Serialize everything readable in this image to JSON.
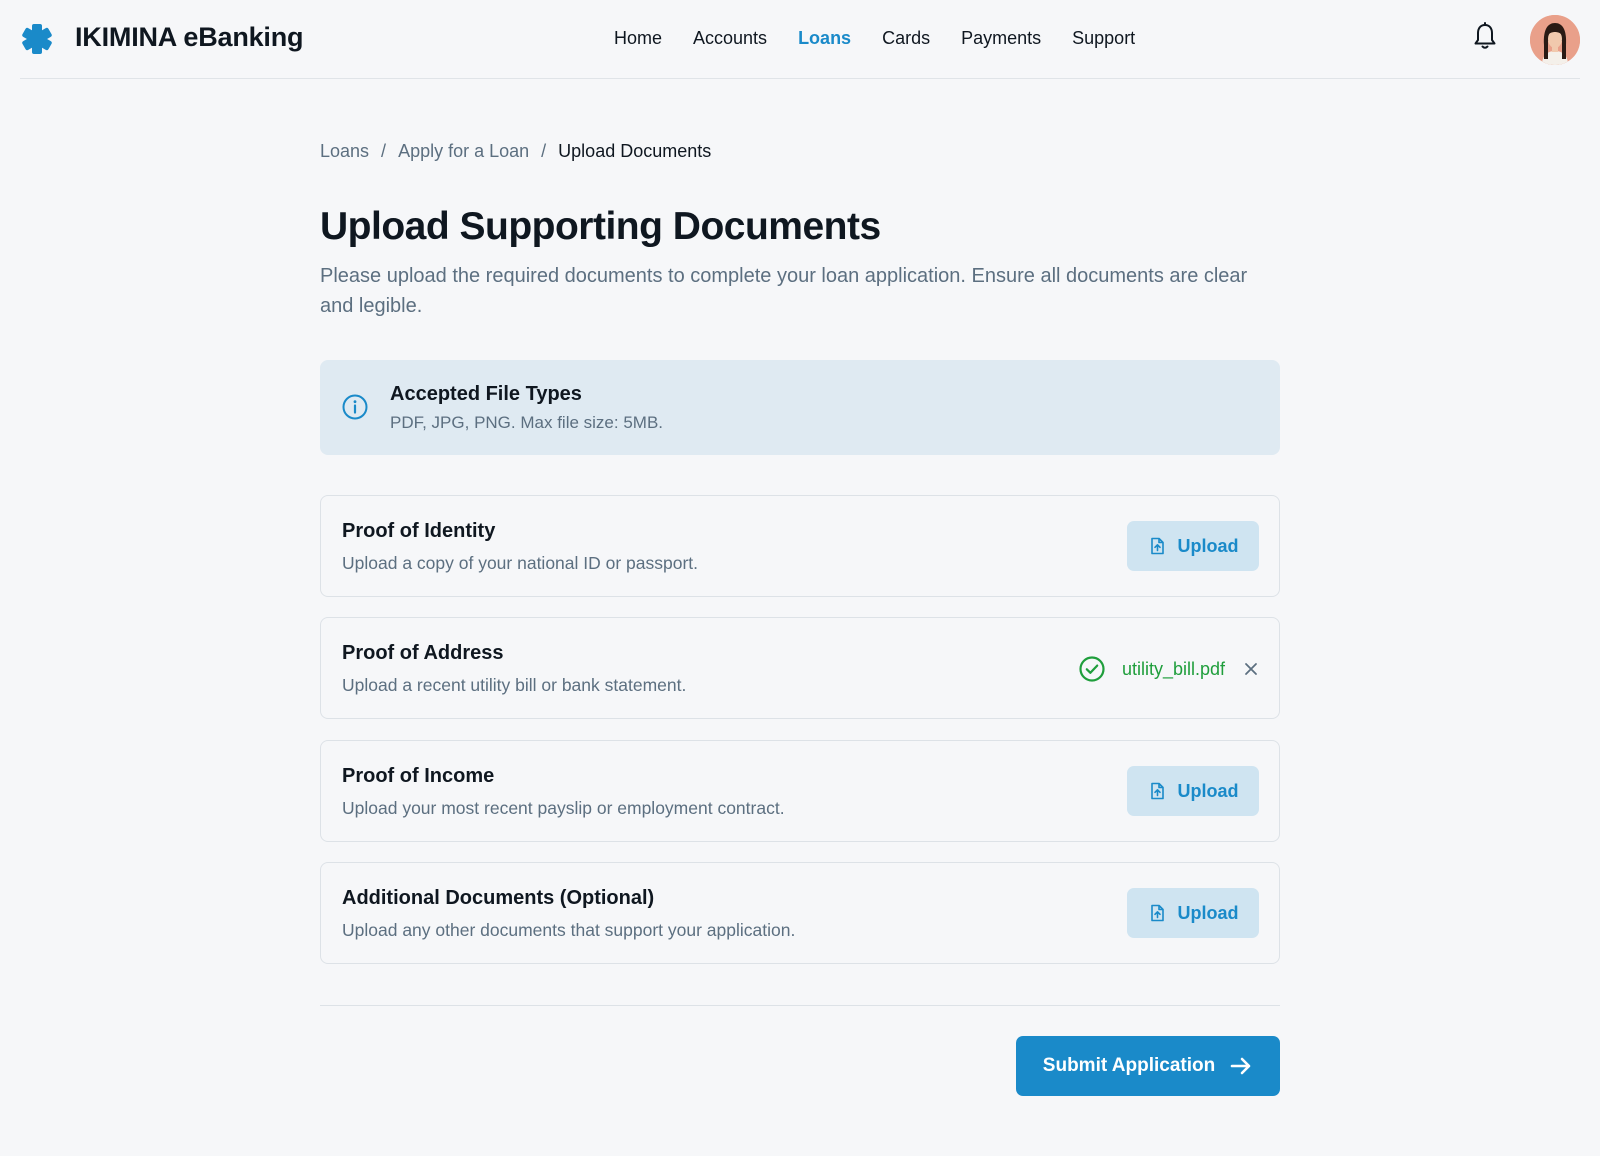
{
  "header": {
    "brand": "IKIMINA eBanking",
    "nav": [
      "Home",
      "Accounts",
      "Loans",
      "Cards",
      "Payments",
      "Support"
    ],
    "active_nav": "Loans"
  },
  "breadcrumb": {
    "items": [
      "Loans",
      "Apply for a Loan"
    ],
    "current": "Upload Documents",
    "separator": "/"
  },
  "page": {
    "title": "Upload Supporting Documents",
    "description": "Please upload the required documents to complete your loan application. Ensure all documents are clear and legible."
  },
  "info": {
    "title": "Accepted File Types",
    "text": "PDF, JPG, PNG. Max file size: 5MB."
  },
  "documents": [
    {
      "title": "Proof of Identity",
      "description": "Upload a copy of your national ID or passport.",
      "action": "Upload"
    },
    {
      "title": "Proof of Address",
      "description": "Upload a recent utility bill or bank statement.",
      "file": "utility_bill.pdf"
    },
    {
      "title": "Proof of Income",
      "description": "Upload your most recent payslip or employment contract.",
      "action": "Upload"
    },
    {
      "title": "Additional Documents (Optional)",
      "description": "Upload any other documents that support your application.",
      "action": "Upload"
    }
  ],
  "submit_label": "Submit Application",
  "colors": {
    "accent": "#1a8ac9",
    "success": "#1f9e3c",
    "info_bg": "#dfeaf2",
    "upload_bg": "#cfe4f1"
  }
}
